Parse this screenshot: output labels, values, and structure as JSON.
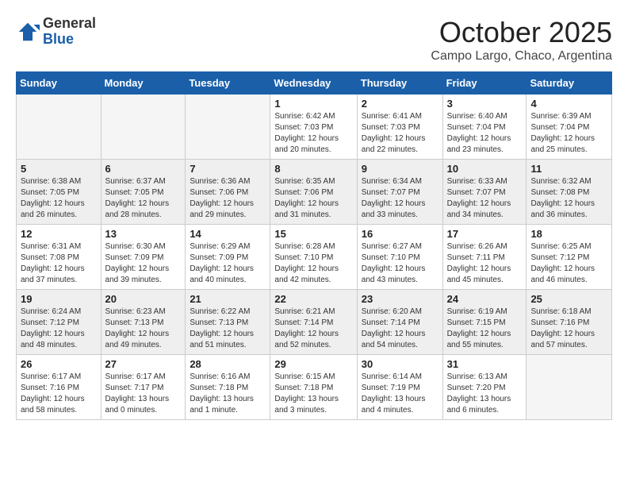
{
  "logo": {
    "general": "General",
    "blue": "Blue"
  },
  "title": "October 2025",
  "location": "Campo Largo, Chaco, Argentina",
  "days_of_week": [
    "Sunday",
    "Monday",
    "Tuesday",
    "Wednesday",
    "Thursday",
    "Friday",
    "Saturday"
  ],
  "weeks": [
    {
      "shaded": false,
      "days": [
        {
          "num": "",
          "empty": true,
          "info": ""
        },
        {
          "num": "",
          "empty": true,
          "info": ""
        },
        {
          "num": "",
          "empty": true,
          "info": ""
        },
        {
          "num": "1",
          "empty": false,
          "info": "Sunrise: 6:42 AM\nSunset: 7:03 PM\nDaylight: 12 hours\nand 20 minutes."
        },
        {
          "num": "2",
          "empty": false,
          "info": "Sunrise: 6:41 AM\nSunset: 7:03 PM\nDaylight: 12 hours\nand 22 minutes."
        },
        {
          "num": "3",
          "empty": false,
          "info": "Sunrise: 6:40 AM\nSunset: 7:04 PM\nDaylight: 12 hours\nand 23 minutes."
        },
        {
          "num": "4",
          "empty": false,
          "info": "Sunrise: 6:39 AM\nSunset: 7:04 PM\nDaylight: 12 hours\nand 25 minutes."
        }
      ]
    },
    {
      "shaded": true,
      "days": [
        {
          "num": "5",
          "empty": false,
          "info": "Sunrise: 6:38 AM\nSunset: 7:05 PM\nDaylight: 12 hours\nand 26 minutes."
        },
        {
          "num": "6",
          "empty": false,
          "info": "Sunrise: 6:37 AM\nSunset: 7:05 PM\nDaylight: 12 hours\nand 28 minutes."
        },
        {
          "num": "7",
          "empty": false,
          "info": "Sunrise: 6:36 AM\nSunset: 7:06 PM\nDaylight: 12 hours\nand 29 minutes."
        },
        {
          "num": "8",
          "empty": false,
          "info": "Sunrise: 6:35 AM\nSunset: 7:06 PM\nDaylight: 12 hours\nand 31 minutes."
        },
        {
          "num": "9",
          "empty": false,
          "info": "Sunrise: 6:34 AM\nSunset: 7:07 PM\nDaylight: 12 hours\nand 33 minutes."
        },
        {
          "num": "10",
          "empty": false,
          "info": "Sunrise: 6:33 AM\nSunset: 7:07 PM\nDaylight: 12 hours\nand 34 minutes."
        },
        {
          "num": "11",
          "empty": false,
          "info": "Sunrise: 6:32 AM\nSunset: 7:08 PM\nDaylight: 12 hours\nand 36 minutes."
        }
      ]
    },
    {
      "shaded": false,
      "days": [
        {
          "num": "12",
          "empty": false,
          "info": "Sunrise: 6:31 AM\nSunset: 7:08 PM\nDaylight: 12 hours\nand 37 minutes."
        },
        {
          "num": "13",
          "empty": false,
          "info": "Sunrise: 6:30 AM\nSunset: 7:09 PM\nDaylight: 12 hours\nand 39 minutes."
        },
        {
          "num": "14",
          "empty": false,
          "info": "Sunrise: 6:29 AM\nSunset: 7:09 PM\nDaylight: 12 hours\nand 40 minutes."
        },
        {
          "num": "15",
          "empty": false,
          "info": "Sunrise: 6:28 AM\nSunset: 7:10 PM\nDaylight: 12 hours\nand 42 minutes."
        },
        {
          "num": "16",
          "empty": false,
          "info": "Sunrise: 6:27 AM\nSunset: 7:10 PM\nDaylight: 12 hours\nand 43 minutes."
        },
        {
          "num": "17",
          "empty": false,
          "info": "Sunrise: 6:26 AM\nSunset: 7:11 PM\nDaylight: 12 hours\nand 45 minutes."
        },
        {
          "num": "18",
          "empty": false,
          "info": "Sunrise: 6:25 AM\nSunset: 7:12 PM\nDaylight: 12 hours\nand 46 minutes."
        }
      ]
    },
    {
      "shaded": true,
      "days": [
        {
          "num": "19",
          "empty": false,
          "info": "Sunrise: 6:24 AM\nSunset: 7:12 PM\nDaylight: 12 hours\nand 48 minutes."
        },
        {
          "num": "20",
          "empty": false,
          "info": "Sunrise: 6:23 AM\nSunset: 7:13 PM\nDaylight: 12 hours\nand 49 minutes."
        },
        {
          "num": "21",
          "empty": false,
          "info": "Sunrise: 6:22 AM\nSunset: 7:13 PM\nDaylight: 12 hours\nand 51 minutes."
        },
        {
          "num": "22",
          "empty": false,
          "info": "Sunrise: 6:21 AM\nSunset: 7:14 PM\nDaylight: 12 hours\nand 52 minutes."
        },
        {
          "num": "23",
          "empty": false,
          "info": "Sunrise: 6:20 AM\nSunset: 7:14 PM\nDaylight: 12 hours\nand 54 minutes."
        },
        {
          "num": "24",
          "empty": false,
          "info": "Sunrise: 6:19 AM\nSunset: 7:15 PM\nDaylight: 12 hours\nand 55 minutes."
        },
        {
          "num": "25",
          "empty": false,
          "info": "Sunrise: 6:18 AM\nSunset: 7:16 PM\nDaylight: 12 hours\nand 57 minutes."
        }
      ]
    },
    {
      "shaded": false,
      "days": [
        {
          "num": "26",
          "empty": false,
          "info": "Sunrise: 6:17 AM\nSunset: 7:16 PM\nDaylight: 12 hours\nand 58 minutes."
        },
        {
          "num": "27",
          "empty": false,
          "info": "Sunrise: 6:17 AM\nSunset: 7:17 PM\nDaylight: 13 hours\nand 0 minutes."
        },
        {
          "num": "28",
          "empty": false,
          "info": "Sunrise: 6:16 AM\nSunset: 7:18 PM\nDaylight: 13 hours\nand 1 minute."
        },
        {
          "num": "29",
          "empty": false,
          "info": "Sunrise: 6:15 AM\nSunset: 7:18 PM\nDaylight: 13 hours\nand 3 minutes."
        },
        {
          "num": "30",
          "empty": false,
          "info": "Sunrise: 6:14 AM\nSunset: 7:19 PM\nDaylight: 13 hours\nand 4 minutes."
        },
        {
          "num": "31",
          "empty": false,
          "info": "Sunrise: 6:13 AM\nSunset: 7:20 PM\nDaylight: 13 hours\nand 6 minutes."
        },
        {
          "num": "",
          "empty": true,
          "info": ""
        }
      ]
    }
  ]
}
